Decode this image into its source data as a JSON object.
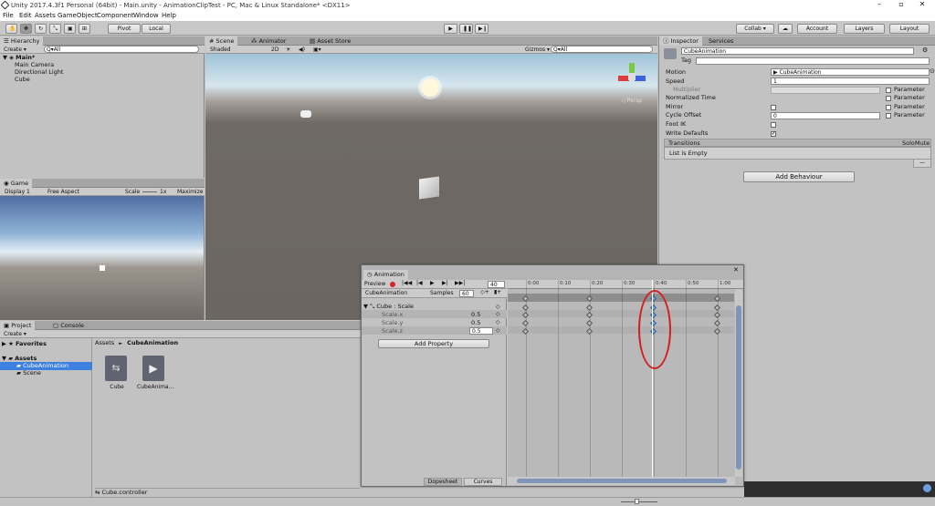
{
  "window": {
    "title": "Unity 2017.4.3f1 Personal (64bit) - Main.unity - AnimationClipTest - PC, Mac & Linux Standalone* <DX11>"
  },
  "menu": [
    "File",
    "Edit",
    "Assets",
    "GameObject",
    "Component",
    "Window",
    "Help"
  ],
  "toolbar": {
    "pivot": "Pivot",
    "local": "Local",
    "collab": "Collab ▾",
    "account": "Account",
    "layers": "Layers",
    "layout": "Layout"
  },
  "hierarchy": {
    "tab": "Hierarchy",
    "create": "Create ▾",
    "search": "Q▾All",
    "scene": "Main*",
    "items": [
      "Main Camera",
      "Directional Light",
      "Cube"
    ]
  },
  "scene": {
    "tabs": [
      "Scene",
      "Animator",
      "Asset Store"
    ],
    "shaded": "Shaded",
    "mode2d": "2D",
    "gizmos": "Gizmos ▾",
    "search": "Q▾All",
    "persp": "Persp"
  },
  "game": {
    "tab": "Game",
    "display": "Display 1",
    "aspect": "Free Aspect",
    "scale": "Scale",
    "scale_value": "1x",
    "maximize": "Maximize O"
  },
  "project": {
    "tabs": [
      "Project",
      "Console"
    ],
    "create": "Create ▾",
    "favorites": "Favorites",
    "assets": "Assets",
    "tree": [
      "CubeAnimation",
      "Scene"
    ],
    "breadcrumb_root": "Assets",
    "breadcrumb_sep": "►",
    "breadcrumb_leaf": "CubeAnimation",
    "files": [
      "Cube",
      "CubeAnima..."
    ],
    "footer": "Cube.controller"
  },
  "inspector": {
    "tabs": [
      "Inspector",
      "Services"
    ],
    "name": "CubeAnimation",
    "tag": "Tag",
    "rows": [
      {
        "label": "Motion",
        "value": "CubeAnimation"
      },
      {
        "label": "Speed",
        "value": "1"
      },
      {
        "label": "Multiplier",
        "value": ""
      },
      {
        "label": "Normalized Time",
        "value": ""
      },
      {
        "label": "Mirror",
        "value": ""
      },
      {
        "label": "Cycle Offset",
        "value": "0"
      },
      {
        "label": "Foot IK",
        "value": ""
      },
      {
        "label": "Write Defaults",
        "value": "✔"
      }
    ],
    "parameter": "Parameter",
    "transitions": "Transitions",
    "solo": "Solo",
    "mute": "Mute",
    "list_empty": "List is Empty",
    "list_buttons": "—",
    "add_behaviour": "Add Behaviour"
  },
  "animation": {
    "tab": "Animation",
    "preview": "Preview",
    "frame": "40",
    "clip": "CubeAnimation",
    "samples_label": "Samples",
    "samples": "60",
    "group": "Cube : Scale",
    "props": [
      {
        "name": "Scale.x",
        "value": "0.5"
      },
      {
        "name": "Scale.y",
        "value": "0.5"
      },
      {
        "name": "Scale.z",
        "value": "0.5"
      }
    ],
    "add_property": "Add Property",
    "ticks": [
      "0:00",
      "0:10",
      "0:20",
      "0:30",
      "0:40",
      "0:50",
      "1:00"
    ],
    "dopesheet": "Dopesheet",
    "curves": "Curves"
  }
}
